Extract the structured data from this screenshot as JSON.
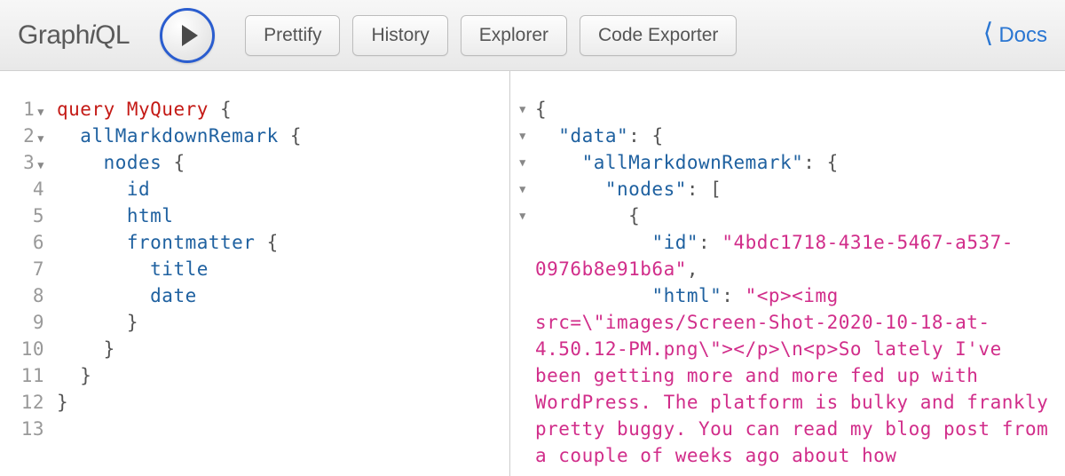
{
  "toolbar": {
    "logo_prefix": "Graph",
    "logo_i": "i",
    "logo_suffix": "QL",
    "prettify": "Prettify",
    "history": "History",
    "explorer": "Explorer",
    "exporter": "Code Exporter",
    "docs": "Docs"
  },
  "editor": {
    "lines": [
      {
        "n": "1",
        "fold": true
      },
      {
        "n": "2",
        "fold": true
      },
      {
        "n": "3",
        "fold": true
      },
      {
        "n": "4",
        "fold": false
      },
      {
        "n": "5",
        "fold": false
      },
      {
        "n": "6",
        "fold": false
      },
      {
        "n": "7",
        "fold": false
      },
      {
        "n": "8",
        "fold": false
      },
      {
        "n": "9",
        "fold": false
      },
      {
        "n": "10",
        "fold": false
      },
      {
        "n": "11",
        "fold": false
      },
      {
        "n": "12",
        "fold": false
      },
      {
        "n": "13",
        "fold": false
      }
    ],
    "l1_kw": "query",
    "l1_name": "MyQuery",
    "l2": "allMarkdownRemark",
    "l3": "nodes",
    "l4": "id",
    "l5": "html",
    "l6": "frontmatter",
    "l7": "title",
    "l8": "date"
  },
  "result": {
    "folds": 5,
    "k_data": "\"data\"",
    "k_amr": "\"allMarkdownRemark\"",
    "k_nodes": "\"nodes\"",
    "k_id": "\"id\"",
    "v_id": "\"4bdc1718-431e-5467-a537-0976b8e91b6a\"",
    "k_html": "\"html\"",
    "v_html": "\"<p><img src=\\\"images/Screen-Shot-2020-10-18-at-4.50.12-PM.png\\\"></p>\\n<p>So lately I've been getting more and more fed up with WordPress. The platform is bulky and frankly pretty buggy. You can read my blog post from a couple of weeks ago about how"
  }
}
